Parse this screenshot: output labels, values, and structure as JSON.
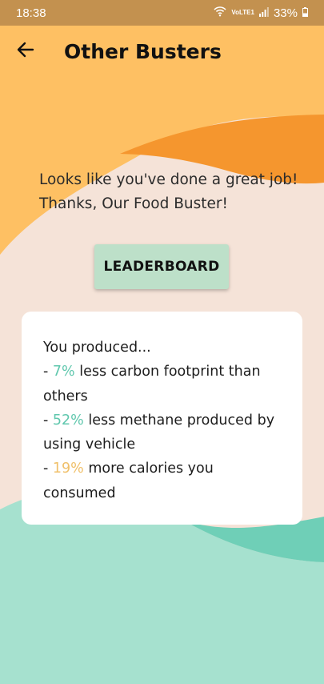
{
  "status": {
    "time": "18:38",
    "network_label": "VoLTE1",
    "battery": "33%"
  },
  "header": {
    "title": "Other Busters"
  },
  "message": {
    "line1": "Looks like you've done a great job!",
    "line2": "Thanks, Our Food Buster!"
  },
  "leaderboard_button": "LEADERBOARD",
  "card": {
    "intro": "You produced...",
    "items": [
      {
        "prefix": "- ",
        "value": "7%",
        "text": " less carbon footprint than others"
      },
      {
        "prefix": "- ",
        "value": "52%",
        "text": " less methane produced by using vehicle"
      },
      {
        "prefix": "- ",
        "value": "19%",
        "text": " more calories you consumed"
      }
    ]
  },
  "colors": {
    "statusbar": "#c3914f",
    "top_yellow": "#fec063",
    "orange_wave": "#f5962e",
    "peach_bg": "#f5e3d8",
    "teal_bg": "#a6e1cf",
    "teal_accent": "#5fc7ad",
    "gold_accent": "#f0c06a",
    "button_bg": "#bde0c9"
  },
  "icons": {
    "back": "arrow-left-icon",
    "wifi": "wifi-icon",
    "signal": "signal-icon",
    "battery": "battery-icon"
  }
}
